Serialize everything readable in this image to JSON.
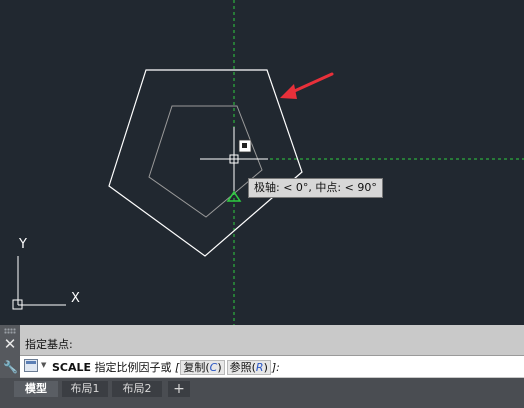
{
  "colors": {
    "canvas_bg": "#212830",
    "crosshair": "#ffffff",
    "tracking_line": "#2ecc40",
    "arrow": "#e8303a",
    "pentagon_outer": "#ffffff",
    "pentagon_inner": "#9a9a9a"
  },
  "canvas": {
    "ucs_x_label": "X",
    "ucs_y_label": "Y",
    "tooltip": "极轴: < 0°, 中点: < 90°"
  },
  "command": {
    "history_line": "指定基点:",
    "command_name": "SCALE",
    "prompt": "指定比例因子或",
    "bracket_open": "[",
    "options": [
      {
        "label": "复制",
        "key": "C"
      },
      {
        "label": "参照",
        "key": "R"
      }
    ],
    "bracket_close": "]:",
    "icons": {
      "close": "close-icon",
      "customize": "wrench-icon"
    }
  },
  "tabs": [
    {
      "label": "模型",
      "active": true
    },
    {
      "label": "布局1",
      "active": false
    },
    {
      "label": "布局2",
      "active": false
    },
    {
      "label": "+",
      "active": false
    }
  ]
}
